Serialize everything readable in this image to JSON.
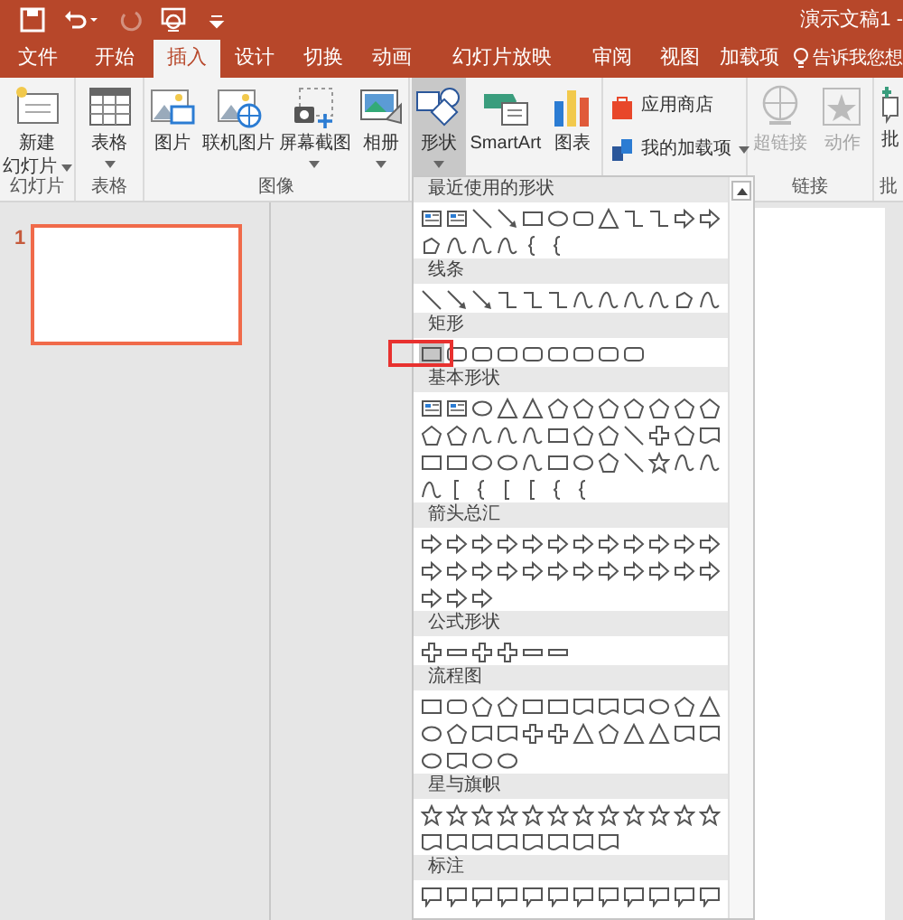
{
  "quick_access": [
    {
      "kind": "save",
      "disabled": false
    },
    {
      "kind": "undo",
      "disabled": false
    },
    {
      "kind": "redo",
      "disabled": true
    },
    {
      "kind": "start",
      "disabled": false
    },
    {
      "kind": "customize",
      "disabled": false
    }
  ],
  "window": {
    "title": "演示文稿1 -"
  },
  "tabs": [
    {
      "label": "文件",
      "selected": false
    },
    {
      "label": "开始",
      "selected": false
    },
    {
      "label": "插入",
      "selected": true
    },
    {
      "label": "设计",
      "selected": false
    },
    {
      "label": "切换",
      "selected": false
    },
    {
      "label": "动画",
      "selected": false
    },
    {
      "label": "幻灯片放映",
      "selected": false
    },
    {
      "label": "审阅",
      "selected": false
    },
    {
      "label": "视图",
      "selected": false
    },
    {
      "label": "加载项",
      "selected": false
    }
  ],
  "tell_me": "告诉我您想",
  "ribbon": [
    {
      "label": "幻灯片",
      "commands": [
        {
          "kind": "new-slide",
          "label_lines": [
            "新建",
            "幻灯片"
          ],
          "dropdown": true
        }
      ]
    },
    {
      "label": "表格",
      "commands": [
        {
          "kind": "table",
          "label_lines": [
            "表格"
          ],
          "dropdown": true
        }
      ]
    },
    {
      "label": "图像",
      "commands": [
        {
          "kind": "picture",
          "label_lines": [
            "图片"
          ],
          "dropdown": false
        },
        {
          "kind": "online-picture",
          "label_lines": [
            "联机图片"
          ],
          "dropdown": false
        },
        {
          "kind": "screenshot",
          "label_lines": [
            "屏幕截图"
          ],
          "dropdown": true
        },
        {
          "kind": "album",
          "label_lines": [
            "相册"
          ],
          "dropdown": true
        }
      ]
    },
    {
      "commands": [
        {
          "kind": "shapes",
          "label_lines": [
            "形状"
          ],
          "dropdown": true,
          "pressed": true
        },
        {
          "kind": "smartart",
          "label_lines": [
            "SmartArt"
          ],
          "dropdown": false
        },
        {
          "kind": "chart",
          "label_lines": [
            "图表"
          ],
          "dropdown": false
        }
      ]
    },
    {
      "small": true,
      "commands": [
        {
          "kind": "store",
          "label_lines": [
            "应用商店"
          ],
          "dropdown": false
        },
        {
          "kind": "addins",
          "label_lines": [
            "我的加载项"
          ],
          "dropdown": true
        }
      ]
    },
    {
      "label": "链接",
      "commands": [
        {
          "kind": "hyperlink",
          "label_lines": [
            "超链接"
          ],
          "dropdown": false,
          "disabled": true
        },
        {
          "kind": "action",
          "label_lines": [
            "动作"
          ],
          "dropdown": false,
          "disabled": true
        }
      ]
    },
    {
      "label": "批",
      "commands": [
        {
          "kind": "comment",
          "label_lines": [
            "批"
          ],
          "dropdown": false
        }
      ]
    }
  ],
  "slides": [
    {
      "number": "1",
      "selected": true
    }
  ],
  "shape_gallery": {
    "sections": [
      {
        "title": "最近使用的形状",
        "shapes": [
          {
            "kind": "textbox",
            "selected": false
          },
          {
            "kind": "textbox",
            "selected": false
          },
          {
            "kind": "line",
            "selected": false
          },
          {
            "kind": "arrowline",
            "selected": false
          },
          {
            "kind": "rect",
            "selected": false
          },
          {
            "kind": "ellipse",
            "selected": false
          },
          {
            "kind": "roundrect",
            "selected": false
          },
          {
            "kind": "triangle",
            "selected": false
          },
          {
            "kind": "connector",
            "selected": false
          },
          {
            "kind": "connector",
            "selected": false
          },
          {
            "kind": "arrow",
            "selected": false
          },
          {
            "kind": "arrow",
            "selected": false
          },
          {
            "kind": "freeform",
            "selected": false
          },
          {
            "kind": "curve",
            "selected": false
          },
          {
            "kind": "curve",
            "selected": false
          },
          {
            "kind": "curve",
            "selected": false
          },
          {
            "kind": "brace",
            "selected": false
          },
          {
            "kind": "brace",
            "selected": false
          }
        ]
      },
      {
        "title": "线条",
        "shapes": [
          {
            "kind": "line",
            "selected": false
          },
          {
            "kind": "arrowline",
            "selected": false
          },
          {
            "kind": "arrowline",
            "selected": false
          },
          {
            "kind": "connector",
            "selected": false
          },
          {
            "kind": "connector",
            "selected": false
          },
          {
            "kind": "connector",
            "selected": false
          },
          {
            "kind": "curve",
            "selected": false
          },
          {
            "kind": "curve",
            "selected": false
          },
          {
            "kind": "curve",
            "selected": false
          },
          {
            "kind": "curve",
            "selected": false
          },
          {
            "kind": "freeform",
            "selected": false
          },
          {
            "kind": "curve",
            "selected": false
          }
        ]
      },
      {
        "title": "矩形",
        "shapes": [
          {
            "kind": "rect",
            "selected": true
          },
          {
            "kind": "roundrect",
            "selected": false
          },
          {
            "kind": "roundrect",
            "selected": false
          },
          {
            "kind": "roundrect",
            "selected": false
          },
          {
            "kind": "roundrect",
            "selected": false
          },
          {
            "kind": "roundrect",
            "selected": false
          },
          {
            "kind": "roundrect",
            "selected": false
          },
          {
            "kind": "roundrect",
            "selected": false
          },
          {
            "kind": "roundrect",
            "selected": false
          }
        ]
      },
      {
        "title": "基本形状",
        "shapes": [
          {
            "kind": "textbox",
            "selected": false
          },
          {
            "kind": "textbox",
            "selected": false
          },
          {
            "kind": "ellipse",
            "selected": false
          },
          {
            "kind": "triangle",
            "selected": false
          },
          {
            "kind": "triangle",
            "selected": false
          },
          {
            "kind": "polygon",
            "selected": false
          },
          {
            "kind": "polygon",
            "selected": false
          },
          {
            "kind": "polygon",
            "selected": false
          },
          {
            "kind": "polygon",
            "selected": false
          },
          {
            "kind": "polygon",
            "selected": false
          },
          {
            "kind": "polygon",
            "selected": false
          },
          {
            "kind": "polygon",
            "selected": false
          },
          {
            "kind": "polygon",
            "selected": false
          },
          {
            "kind": "polygon",
            "selected": false
          },
          {
            "kind": "curve",
            "selected": false
          },
          {
            "kind": "curve",
            "selected": false
          },
          {
            "kind": "curve",
            "selected": false
          },
          {
            "kind": "rect",
            "selected": false
          },
          {
            "kind": "polygon",
            "selected": false
          },
          {
            "kind": "polygon",
            "selected": false
          },
          {
            "kind": "line",
            "selected": false
          },
          {
            "kind": "plus",
            "selected": false
          },
          {
            "kind": "polygon",
            "selected": false
          },
          {
            "kind": "flow",
            "selected": false
          },
          {
            "kind": "rect",
            "selected": false
          },
          {
            "kind": "rect",
            "selected": false
          },
          {
            "kind": "ellipse",
            "selected": false
          },
          {
            "kind": "ellipse",
            "selected": false
          },
          {
            "kind": "curve",
            "selected": false
          },
          {
            "kind": "rect",
            "selected": false
          },
          {
            "kind": "ellipse",
            "selected": false
          },
          {
            "kind": "polygon",
            "selected": false
          },
          {
            "kind": "line",
            "selected": false
          },
          {
            "kind": "star",
            "selected": false
          },
          {
            "kind": "curve",
            "selected": false
          },
          {
            "kind": "curve",
            "selected": false
          },
          {
            "kind": "curve",
            "selected": false
          },
          {
            "kind": "bracket",
            "selected": false
          },
          {
            "kind": "brace",
            "selected": false
          },
          {
            "kind": "bracket",
            "selected": false
          },
          {
            "kind": "bracket",
            "selected": false
          },
          {
            "kind": "brace",
            "selected": false
          },
          {
            "kind": "brace",
            "selected": false
          }
        ]
      },
      {
        "title": "箭头总汇",
        "shapes": [
          {
            "kind": "arrow",
            "selected": false
          },
          {
            "kind": "arrow",
            "selected": false
          },
          {
            "kind": "arrow",
            "selected": false
          },
          {
            "kind": "arrow",
            "selected": false
          },
          {
            "kind": "arrow",
            "selected": false
          },
          {
            "kind": "arrow",
            "selected": false
          },
          {
            "kind": "arrow",
            "selected": false
          },
          {
            "kind": "arrow",
            "selected": false
          },
          {
            "kind": "arrow",
            "selected": false
          },
          {
            "kind": "arrow",
            "selected": false
          },
          {
            "kind": "arrow",
            "selected": false
          },
          {
            "kind": "arrow",
            "selected": false
          },
          {
            "kind": "arrow",
            "selected": false
          },
          {
            "kind": "arrow",
            "selected": false
          },
          {
            "kind": "arrow",
            "selected": false
          },
          {
            "kind": "arrow",
            "selected": false
          },
          {
            "kind": "arrow",
            "selected": false
          },
          {
            "kind": "arrow",
            "selected": false
          },
          {
            "kind": "arrow",
            "selected": false
          },
          {
            "kind": "arrow",
            "selected": false
          },
          {
            "kind": "arrow",
            "selected": false
          },
          {
            "kind": "arrow",
            "selected": false
          },
          {
            "kind": "arrow",
            "selected": false
          },
          {
            "kind": "arrow",
            "selected": false
          },
          {
            "kind": "arrow",
            "selected": false
          },
          {
            "kind": "arrow",
            "selected": false
          },
          {
            "kind": "arrow",
            "selected": false
          }
        ]
      },
      {
        "title": "公式形状",
        "shapes": [
          {
            "kind": "plus",
            "selected": false
          },
          {
            "kind": "minus",
            "selected": false
          },
          {
            "kind": "plus",
            "selected": false
          },
          {
            "kind": "plus",
            "selected": false
          },
          {
            "kind": "minus",
            "selected": false
          },
          {
            "kind": "minus",
            "selected": false
          }
        ]
      },
      {
        "title": "流程图",
        "shapes": [
          {
            "kind": "rect",
            "selected": false
          },
          {
            "kind": "roundrect",
            "selected": false
          },
          {
            "kind": "polygon",
            "selected": false
          },
          {
            "kind": "polygon",
            "selected": false
          },
          {
            "kind": "rect",
            "selected": false
          },
          {
            "kind": "rect",
            "selected": false
          },
          {
            "kind": "flow",
            "selected": false
          },
          {
            "kind": "flow",
            "selected": false
          },
          {
            "kind": "flow",
            "selected": false
          },
          {
            "kind": "ellipse",
            "selected": false
          },
          {
            "kind": "polygon",
            "selected": false
          },
          {
            "kind": "triangle",
            "selected": false
          },
          {
            "kind": "ellipse",
            "selected": false
          },
          {
            "kind": "polygon",
            "selected": false
          },
          {
            "kind": "flow",
            "selected": false
          },
          {
            "kind": "flow",
            "selected": false
          },
          {
            "kind": "plus",
            "selected": false
          },
          {
            "kind": "plus",
            "selected": false
          },
          {
            "kind": "triangle",
            "selected": false
          },
          {
            "kind": "polygon",
            "selected": false
          },
          {
            "kind": "triangle",
            "selected": false
          },
          {
            "kind": "triangle",
            "selected": false
          },
          {
            "kind": "flow",
            "selected": false
          },
          {
            "kind": "flow",
            "selected": false
          },
          {
            "kind": "ellipse",
            "selected": false
          },
          {
            "kind": "flow",
            "selected": false
          },
          {
            "kind": "ellipse",
            "selected": false
          },
          {
            "kind": "ellipse",
            "selected": false
          }
        ]
      },
      {
        "title": "星与旗帜",
        "shapes": [
          {
            "kind": "star",
            "selected": false
          },
          {
            "kind": "star",
            "selected": false
          },
          {
            "kind": "star",
            "selected": false
          },
          {
            "kind": "star",
            "selected": false
          },
          {
            "kind": "star",
            "selected": false
          },
          {
            "kind": "star",
            "selected": false
          },
          {
            "kind": "star",
            "selected": false
          },
          {
            "kind": "star",
            "selected": false
          },
          {
            "kind": "star",
            "selected": false
          },
          {
            "kind": "star",
            "selected": false
          },
          {
            "kind": "star",
            "selected": false
          },
          {
            "kind": "star",
            "selected": false
          },
          {
            "kind": "flow",
            "selected": false
          },
          {
            "kind": "flow",
            "selected": false
          },
          {
            "kind": "flow",
            "selected": false
          },
          {
            "kind": "flow",
            "selected": false
          },
          {
            "kind": "flow",
            "selected": false
          },
          {
            "kind": "flow",
            "selected": false
          },
          {
            "kind": "flow",
            "selected": false
          },
          {
            "kind": "flow",
            "selected": false
          }
        ]
      },
      {
        "title": "标注",
        "shapes": [
          {
            "kind": "callout",
            "selected": false
          },
          {
            "kind": "callout",
            "selected": false
          },
          {
            "kind": "callout",
            "selected": false
          },
          {
            "kind": "callout",
            "selected": false
          },
          {
            "kind": "callout",
            "selected": false
          },
          {
            "kind": "callout",
            "selected": false
          },
          {
            "kind": "callout",
            "selected": false
          },
          {
            "kind": "callout",
            "selected": false
          },
          {
            "kind": "callout",
            "selected": false
          },
          {
            "kind": "callout",
            "selected": false
          },
          {
            "kind": "callout",
            "selected": false
          },
          {
            "kind": "callout",
            "selected": false
          }
        ]
      }
    ]
  }
}
